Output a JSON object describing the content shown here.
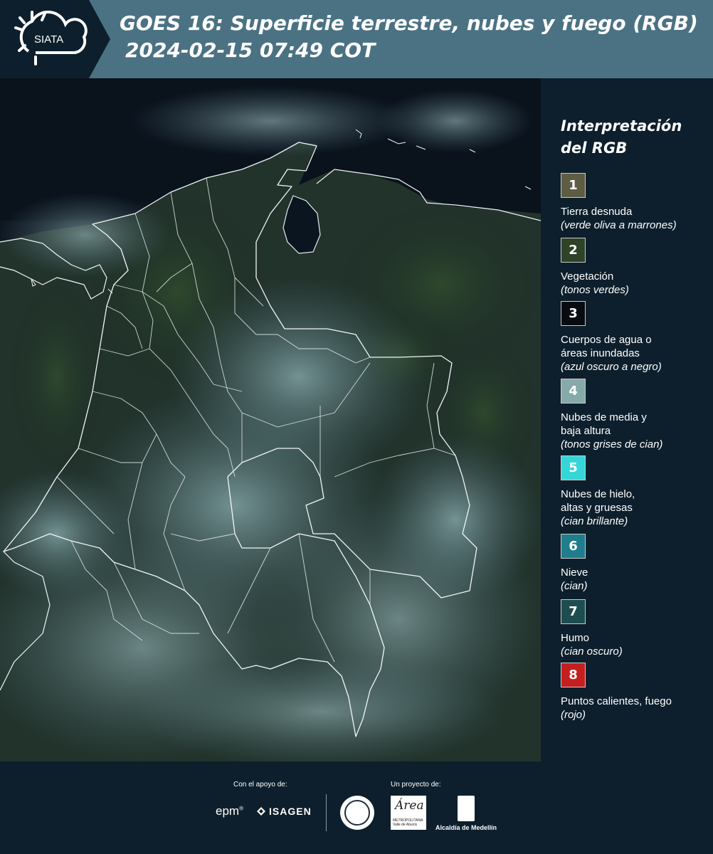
{
  "header": {
    "logo_text": "SIATA",
    "title_line1": "GOES 16: Superficie terrestre, nubes y fuego (RGB)",
    "title_line2": "2024-02-15 07:49 COT"
  },
  "legend": {
    "title_line1": "Interpretación",
    "title_line2": "del RGB",
    "items": [
      {
        "number": "1",
        "color": "#5f5c44",
        "label": "Tierra desnuda",
        "sub": "(verde oliva a marrones)"
      },
      {
        "number": "2",
        "color": "#2e4327",
        "label": "Vegetación",
        "sub": "(tonos verdes)"
      },
      {
        "number": "3",
        "color": "#080c10",
        "label": "Cuerpos de agua o áreas inundadas",
        "sub": "(azul oscuro a negro)"
      },
      {
        "number": "4",
        "color": "#86aaa9",
        "label": "Nubes de media y baja altura",
        "sub": "(tonos grises de cian)"
      },
      {
        "number": "5",
        "color": "#35d6d8",
        "label": "Nubes de hielo, altas y gruesas",
        "sub": "(cian brillante)"
      },
      {
        "number": "6",
        "color": "#1f7d8e",
        "label": "Nieve",
        "sub": "(cian)"
      },
      {
        "number": "7",
        "color": "#1d4d4f",
        "label": "Humo",
        "sub": "(cian oscuro)"
      },
      {
        "number": "8",
        "color": "#c41f1f",
        "label": "Puntos calientes, fuego",
        "sub": "(rojo)"
      }
    ]
  },
  "footer": {
    "support_label": "Con el apoyo de:",
    "project_label": "Un proyecto de:",
    "epm_text": "epm",
    "epm_mark": "®",
    "isagen_text": "ISAGEN",
    "area_text": "Área",
    "area_sub": "METROPOLITANA Valle de Aburrá",
    "alcaldia_text": "Alcaldía de Medellín"
  }
}
